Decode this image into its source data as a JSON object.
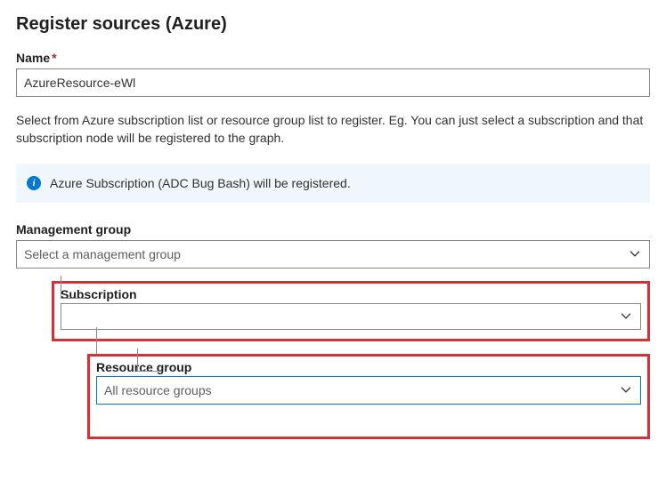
{
  "title": "Register sources (Azure)",
  "name": {
    "label": "Name",
    "required_mark": "*",
    "value": "AzureResource-eWl"
  },
  "help_text": "Select from Azure subscription list or resource group list to register. Eg. You can just select a subscription and that subscription node will be registered to the graph.",
  "info_banner": "Azure Subscription (ADC Bug Bash) will be registered.",
  "management_group": {
    "label": "Management group",
    "placeholder": "Select a management group"
  },
  "subscription": {
    "label": "Subscription",
    "value": ""
  },
  "resource_group": {
    "label": "Resource group",
    "value": "All resource groups"
  }
}
